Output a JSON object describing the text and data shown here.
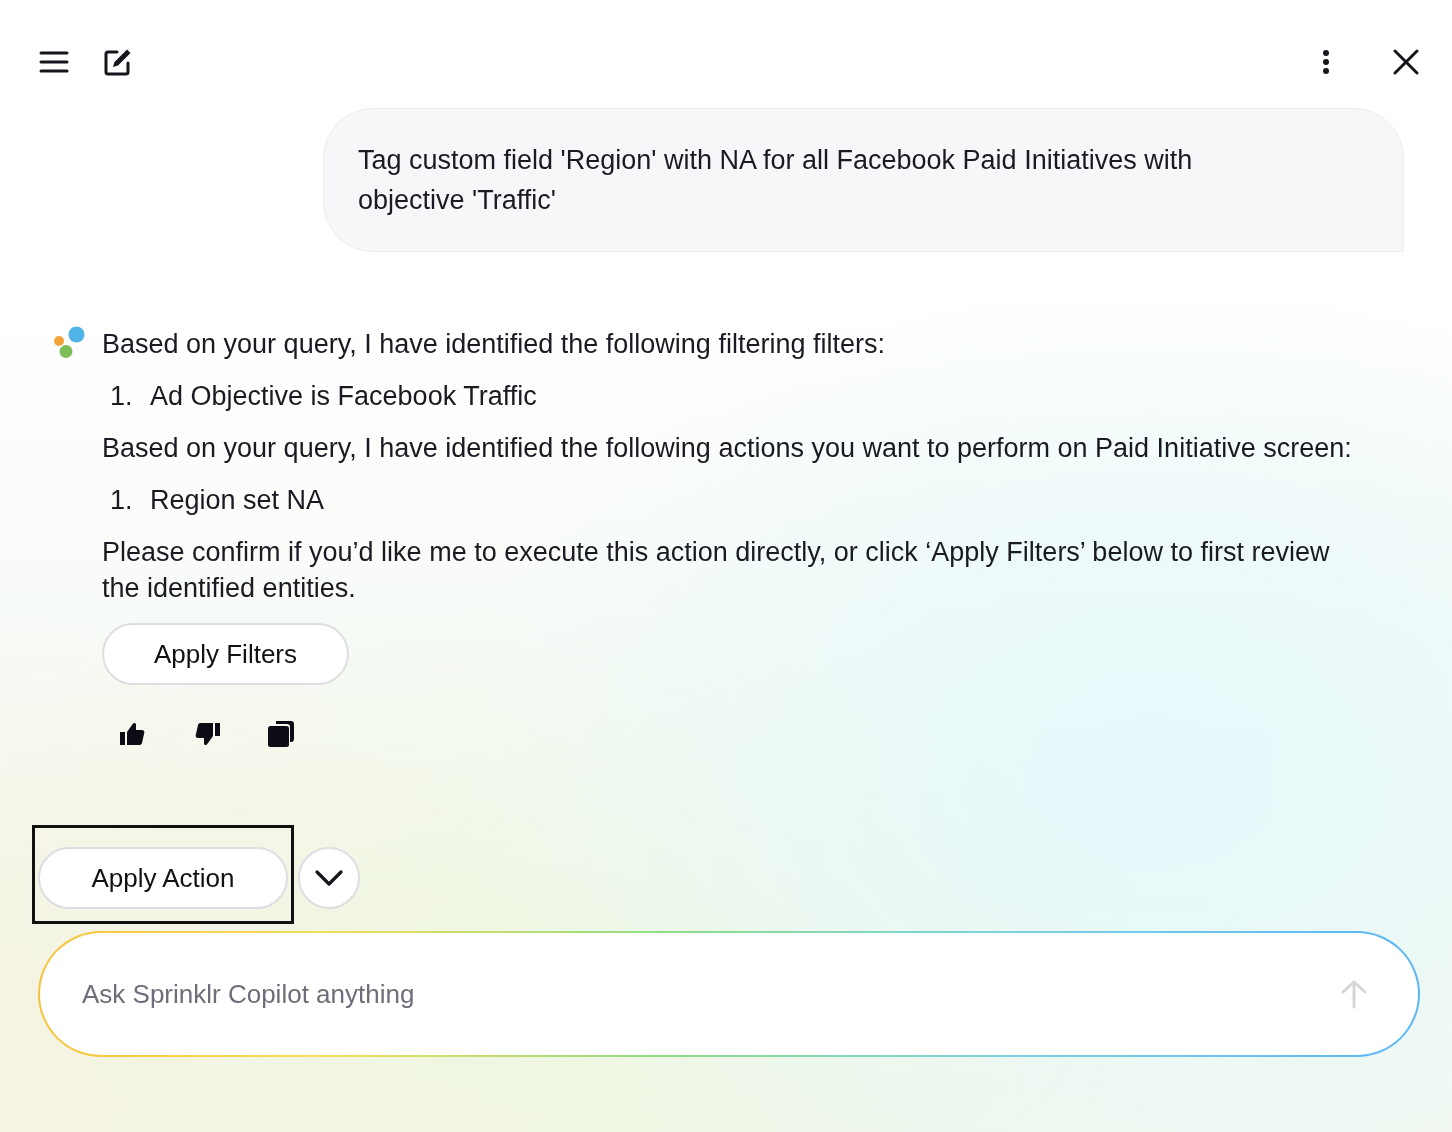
{
  "user_message": {
    "text": "Tag custom field 'Region' with NA for all Facebook Paid Initiatives with objective 'Traffic'"
  },
  "assistant_message": {
    "blocks": [
      {
        "kind": "paragraph",
        "text": "Based on your query, I have identified the following filtering filters:"
      },
      {
        "kind": "list",
        "items": [
          {
            "number": "1.",
            "text": "Ad Objective is Facebook Traffic"
          }
        ]
      },
      {
        "kind": "paragraph",
        "text": "Based on your query, I have identified the following actions you want to perform on Paid Initiative screen:"
      },
      {
        "kind": "list",
        "items": [
          {
            "number": "1.",
            "text": "Region set NA"
          }
        ]
      },
      {
        "kind": "paragraph",
        "text": "Please confirm if you’d like me to execute this action directly, or click ‘Apply Filters’ below to first review the identified entities."
      }
    ],
    "button": "Apply Filters"
  },
  "composer": {
    "action_button": "Apply Action",
    "highlighted": true,
    "placeholder": "Ask Sprinklr Copilot anything"
  }
}
